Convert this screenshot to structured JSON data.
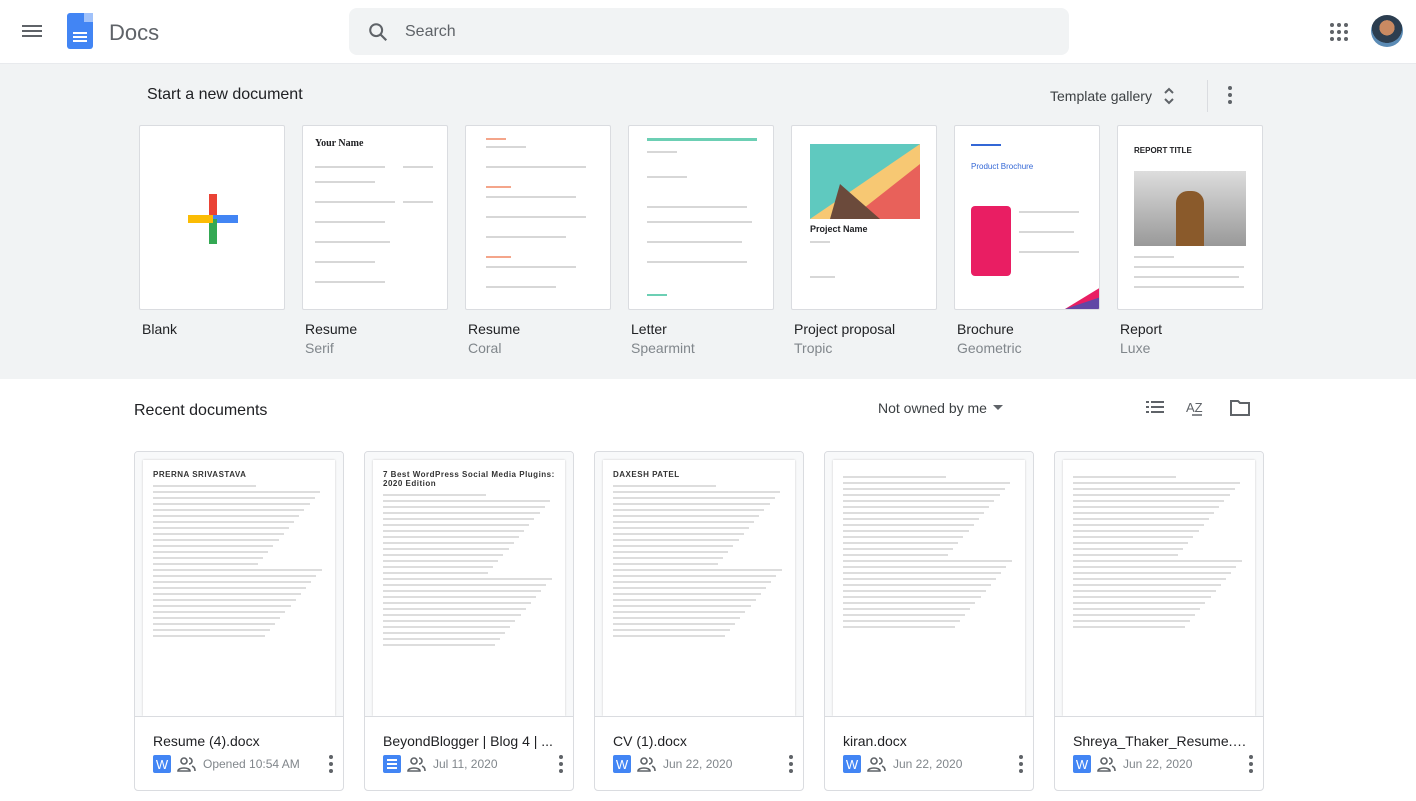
{
  "header": {
    "app_name": "Docs",
    "search_placeholder": "Search",
    "icons": [
      "menu-icon",
      "docs-logo",
      "search-icon",
      "apps-grid-icon",
      "avatar"
    ]
  },
  "templates": {
    "title": "Start a new document",
    "gallery_label": "Template gallery",
    "items": [
      {
        "name": "Blank",
        "sub": ""
      },
      {
        "name": "Resume",
        "sub": "Serif",
        "heading": "Your Name"
      },
      {
        "name": "Resume",
        "sub": "Coral"
      },
      {
        "name": "Letter",
        "sub": "Spearmint"
      },
      {
        "name": "Project proposal",
        "sub": "Tropic",
        "heading": "Project Name"
      },
      {
        "name": "Brochure",
        "sub": "Geometric",
        "heading": "Product Brochure"
      },
      {
        "name": "Report",
        "sub": "Luxe",
        "heading": "REPORT TITLE"
      }
    ]
  },
  "recent": {
    "title": "Recent documents",
    "filter": "Not owned by me",
    "docs": [
      {
        "name": "Resume (4).docx",
        "type": "word",
        "meta": "Opened 10:54 AM",
        "preview_heading": "PRERNA SRIVASTAVA"
      },
      {
        "name": "BeyondBlogger | Blog 4 | ...",
        "type": "docs",
        "meta": "Jul 11, 2020",
        "preview_heading": "7 Best WordPress Social Media Plugins: 2020 Edition"
      },
      {
        "name": "CV (1).docx",
        "type": "word",
        "meta": "Jun 22, 2020",
        "preview_heading": "DAXESH PATEL"
      },
      {
        "name": "kiran.docx",
        "type": "word",
        "meta": "Jun 22, 2020",
        "preview_heading": ""
      },
      {
        "name": "Shreya_Thaker_Resume.d...",
        "type": "word",
        "meta": "Jun 22, 2020",
        "preview_heading": ""
      }
    ]
  },
  "colors": {
    "accent": "#4285f4",
    "template_bg": "#f1f3f4"
  }
}
